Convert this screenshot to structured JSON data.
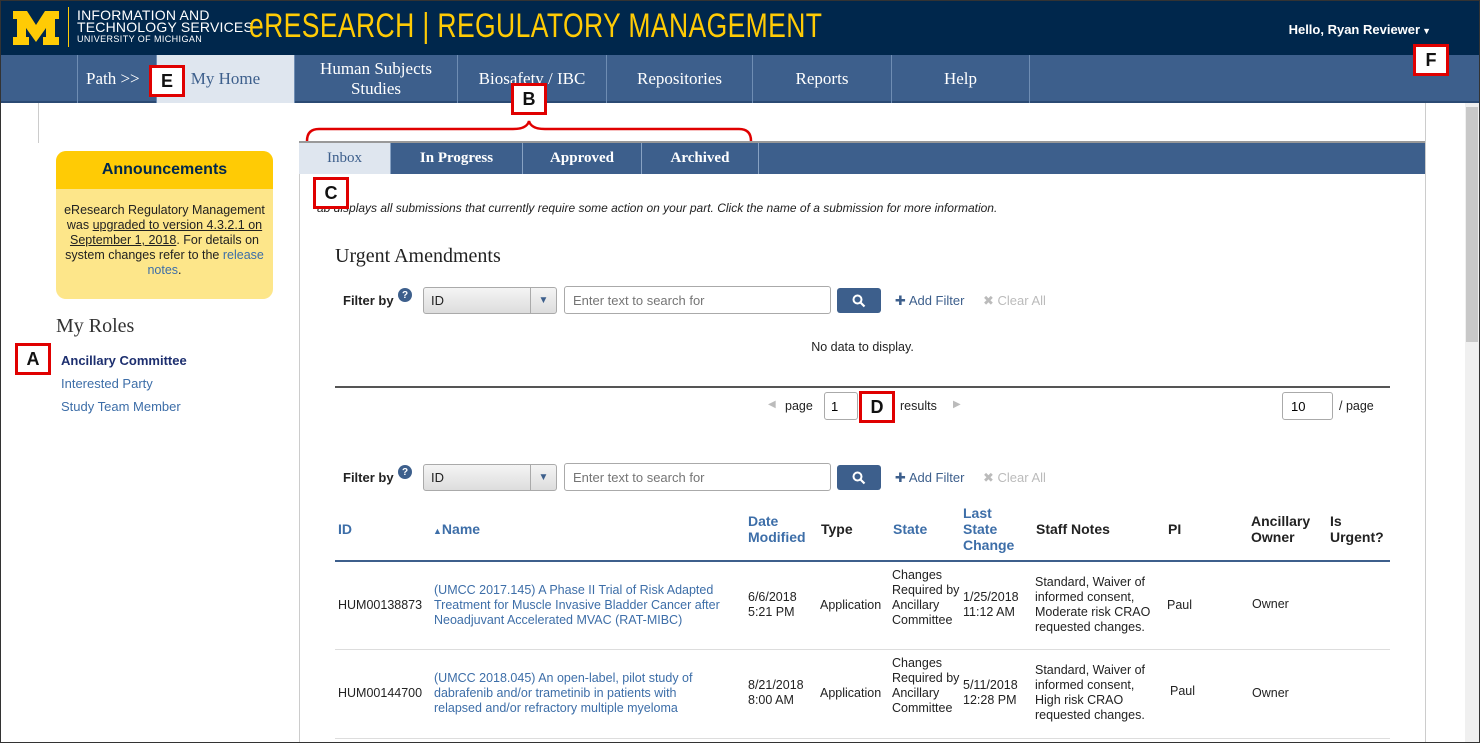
{
  "header": {
    "org_line1": "INFORMATION AND",
    "org_line2": "TECHNOLOGY SERVICES",
    "org_line3": "UNIVERSITY OF MICHIGAN",
    "app_title": "eRESEARCH | REGULATORY MANAGEMENT",
    "greeting": "Hello, Ryan Reviewer",
    "brand_colors": {
      "navy": "#00274c",
      "maize": "#ffcb05",
      "nav_blue": "#3d5f8c"
    }
  },
  "nav": {
    "path": "Path >>",
    "items": [
      "My Home",
      "Human Subjects Studies",
      "Biosafety / IBC",
      "Repositories",
      "Reports",
      "Help"
    ],
    "active": "My Home"
  },
  "sidebar": {
    "announcements": {
      "title": "Announcements",
      "text_a": "eResearch Regulatory Management was ",
      "link_upgrade": "upgraded to version 4.3.2.1 on September 1, 2018",
      "text_b": ". For details on system changes refer to the ",
      "link_notes": "release notes",
      "text_c": "."
    },
    "roles_title": "My Roles",
    "roles": [
      "Ancillary Committee",
      "Interested Party",
      "Study Team Member"
    ]
  },
  "tabs": {
    "items": [
      "Inbox",
      "In Progress",
      "Approved",
      "Archived"
    ],
    "active": "Inbox",
    "description": "ab displays all submissions that currently require some action on your part. Click the name of a submission for more information."
  },
  "urgent": {
    "title": "Urgent Amendments",
    "filter_label": "Filter by",
    "filter_field": "ID",
    "search_placeholder": "Enter text to search for",
    "add_filter": "Add Filter",
    "clear_all": "Clear All",
    "no_data": "No data to display.",
    "pager_page": "page",
    "page_value": "1",
    "results": "results",
    "per_page_value": "10",
    "per_page": "/ page"
  },
  "main_list": {
    "filter_label": "Filter by",
    "filter_field": "ID",
    "search_placeholder": "Enter text to search for",
    "add_filter": "Add Filter",
    "clear_all": "Clear All",
    "columns": {
      "id": "ID",
      "name": "Name",
      "date_modified": "Date Modified",
      "type": "Type",
      "state": "State",
      "last_state_change": "Last State Change",
      "staff_notes": "Staff Notes",
      "pi": "PI",
      "ancillary_owner": "Ancillary Owner",
      "is_urgent": "Is Urgent?"
    },
    "rows": [
      {
        "id": "HUM00138873",
        "name": "(UMCC 2017.145) A Phase II Trial of Risk Adapted Treatment for Muscle Invasive Bladder Cancer after Neoadjuvant Accelerated MVAC (RAT-MIBC)",
        "date_modified": "6/6/2018 5:21 PM",
        "type": "Application",
        "state": "Changes Required by Ancillary Committee",
        "last_state_change": "1/25/2018 11:12 AM",
        "staff_notes": "Standard, Waiver of informed consent, Moderate risk CRAO requested changes.",
        "pi": "Paul",
        "ancillary_owner": "Owner"
      },
      {
        "id": "HUM00144700",
        "name": "(UMCC 2018.045) An open-label, pilot study of dabrafenib and/or trametinib in patients with relapsed and/or refractory multiple myeloma",
        "date_modified": "8/21/2018 8:00 AM",
        "type": "Application",
        "state": "Changes Required by Ancillary Committee",
        "last_state_change": "5/11/2018 12:28 PM",
        "staff_notes": "Standard, Waiver of informed consent, High risk CRAO requested changes.",
        "pi": "Paul",
        "ancillary_owner": "Owner"
      }
    ]
  },
  "callouts": [
    "A",
    "B",
    "C",
    "D",
    "E",
    "F"
  ]
}
